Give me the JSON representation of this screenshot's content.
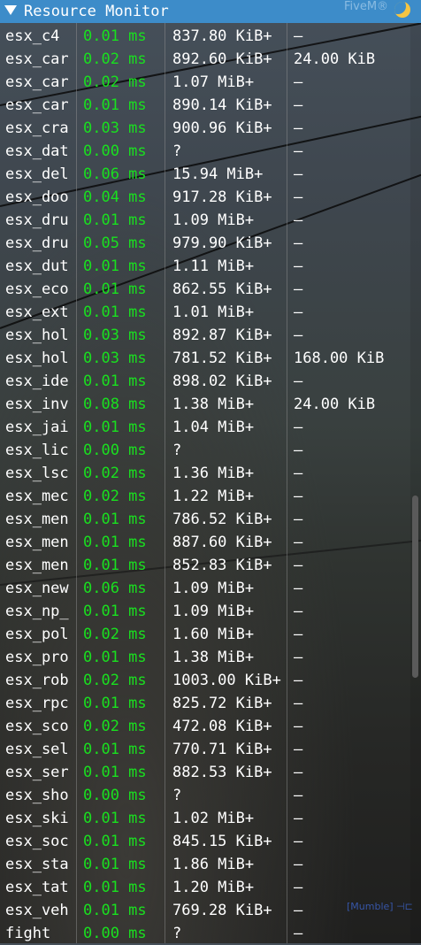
{
  "window": {
    "title": "Resource Monitor",
    "brand": "FiveM®"
  },
  "overlay": {
    "mumble_label": "[Mumble]"
  },
  "resources": [
    {
      "name": "esx_c4",
      "cpu": "0.01 ms",
      "memory": "837.80 KiB+",
      "streaming": "–"
    },
    {
      "name": "esx_car",
      "cpu": "0.02 ms",
      "memory": "892.60 KiB+",
      "streaming": "24.00 KiB"
    },
    {
      "name": "esx_car",
      "cpu": "0.02 ms",
      "memory": "1.07 MiB+",
      "streaming": "–"
    },
    {
      "name": "esx_car",
      "cpu": "0.01 ms",
      "memory": "890.14 KiB+",
      "streaming": "–"
    },
    {
      "name": "esx_cra",
      "cpu": "0.03 ms",
      "memory": "900.96 KiB+",
      "streaming": "–"
    },
    {
      "name": "esx_dat",
      "cpu": "0.00 ms",
      "memory": "?",
      "streaming": "–"
    },
    {
      "name": "esx_del",
      "cpu": "0.06 ms",
      "memory": "15.94 MiB+",
      "streaming": "–"
    },
    {
      "name": "esx_doo",
      "cpu": "0.04 ms",
      "memory": "917.28 KiB+",
      "streaming": "–"
    },
    {
      "name": "esx_dru",
      "cpu": "0.01 ms",
      "memory": "1.09 MiB+",
      "streaming": "–"
    },
    {
      "name": "esx_dru",
      "cpu": "0.05 ms",
      "memory": "979.90 KiB+",
      "streaming": "–"
    },
    {
      "name": "esx_dut",
      "cpu": "0.01 ms",
      "memory": "1.11 MiB+",
      "streaming": "–"
    },
    {
      "name": "esx_eco",
      "cpu": "0.01 ms",
      "memory": "862.55 KiB+",
      "streaming": "–"
    },
    {
      "name": "esx_ext",
      "cpu": "0.01 ms",
      "memory": "1.01 MiB+",
      "streaming": "–"
    },
    {
      "name": "esx_hol",
      "cpu": "0.03 ms",
      "memory": "892.87 KiB+",
      "streaming": "–"
    },
    {
      "name": "esx_hol",
      "cpu": "0.03 ms",
      "memory": "781.52 KiB+",
      "streaming": "168.00 KiB"
    },
    {
      "name": "esx_ide",
      "cpu": "0.01 ms",
      "memory": "898.02 KiB+",
      "streaming": "–"
    },
    {
      "name": "esx_inv",
      "cpu": "0.08 ms",
      "memory": "1.38 MiB+",
      "streaming": "24.00 KiB"
    },
    {
      "name": "esx_jai",
      "cpu": "0.01 ms",
      "memory": "1.04 MiB+",
      "streaming": "–"
    },
    {
      "name": "esx_lic",
      "cpu": "0.00 ms",
      "memory": "?",
      "streaming": "–"
    },
    {
      "name": "esx_lsc",
      "cpu": "0.02 ms",
      "memory": "1.36 MiB+",
      "streaming": "–"
    },
    {
      "name": "esx_mec",
      "cpu": "0.02 ms",
      "memory": "1.22 MiB+",
      "streaming": "–"
    },
    {
      "name": "esx_men",
      "cpu": "0.01 ms",
      "memory": "786.52 KiB+",
      "streaming": "–"
    },
    {
      "name": "esx_men",
      "cpu": "0.01 ms",
      "memory": "887.60 KiB+",
      "streaming": "–"
    },
    {
      "name": "esx_men",
      "cpu": "0.01 ms",
      "memory": "852.83 KiB+",
      "streaming": "–"
    },
    {
      "name": "esx_new",
      "cpu": "0.06 ms",
      "memory": "1.09 MiB+",
      "streaming": "–"
    },
    {
      "name": "esx_np_",
      "cpu": "0.01 ms",
      "memory": "1.09 MiB+",
      "streaming": "–"
    },
    {
      "name": "esx_pol",
      "cpu": "0.02 ms",
      "memory": "1.60 MiB+",
      "streaming": "–"
    },
    {
      "name": "esx_pro",
      "cpu": "0.01 ms",
      "memory": "1.38 MiB+",
      "streaming": "–"
    },
    {
      "name": "esx_rob",
      "cpu": "0.02 ms",
      "memory": "1003.00 KiB+",
      "streaming": "–"
    },
    {
      "name": "esx_rpc",
      "cpu": "0.01 ms",
      "memory": "825.72 KiB+",
      "streaming": "–"
    },
    {
      "name": "esx_sco",
      "cpu": "0.02 ms",
      "memory": "472.08 KiB+",
      "streaming": "–"
    },
    {
      "name": "esx_sel",
      "cpu": "0.01 ms",
      "memory": "770.71 KiB+",
      "streaming": "–"
    },
    {
      "name": "esx_ser",
      "cpu": "0.01 ms",
      "memory": "882.53 KiB+",
      "streaming": "–"
    },
    {
      "name": "esx_sho",
      "cpu": "0.00 ms",
      "memory": "?",
      "streaming": "–"
    },
    {
      "name": "esx_ski",
      "cpu": "0.01 ms",
      "memory": "1.02 MiB+",
      "streaming": "–"
    },
    {
      "name": "esx_soc",
      "cpu": "0.01 ms",
      "memory": "845.15 KiB+",
      "streaming": "–"
    },
    {
      "name": "esx_sta",
      "cpu": "0.01 ms",
      "memory": "1.86 MiB+",
      "streaming": "–"
    },
    {
      "name": "esx_tat",
      "cpu": "0.01 ms",
      "memory": "1.20 MiB+",
      "streaming": "–"
    },
    {
      "name": "esx_veh",
      "cpu": "0.01 ms",
      "memory": "769.28 KiB+",
      "streaming": "–"
    },
    {
      "name": "fight",
      "cpu": "0.00 ms",
      "memory": "?",
      "streaming": "–"
    }
  ]
}
